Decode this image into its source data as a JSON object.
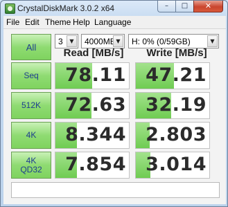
{
  "window": {
    "title": "CrystalDiskMark 3.0.2 x64"
  },
  "title_buttons": {
    "minimize": "–",
    "maximize": "□",
    "close": "✕"
  },
  "menu": [
    "File",
    "Edit",
    "Theme",
    "Help",
    "Language"
  ],
  "controls": {
    "all_label": "All",
    "test_count": "3",
    "test_size": "4000MB",
    "drive": "H: 0% (0/59GB)"
  },
  "columns": {
    "read": "Read [MB/s]",
    "write": "Write [MB/s]"
  },
  "rows": [
    {
      "label": "Seq",
      "read": "78.11",
      "write": "47.21",
      "read_fill": 0.5,
      "write_fill": 0.52
    },
    {
      "label": "512K",
      "read": "72.63",
      "write": "32.19",
      "read_fill": 0.49,
      "write_fill": 0.48
    },
    {
      "label": "4K",
      "read": "8.344",
      "write": "2.803",
      "read_fill": 0.29,
      "write_fill": 0.19
    },
    {
      "label": "4K\nQD32",
      "read": "7.854",
      "write": "3.014",
      "read_fill": 0.29,
      "write_fill": 0.2
    }
  ],
  "comment": "",
  "colors": {
    "accent_green": "#7fd35f",
    "label_blue": "#1e3d8f"
  }
}
